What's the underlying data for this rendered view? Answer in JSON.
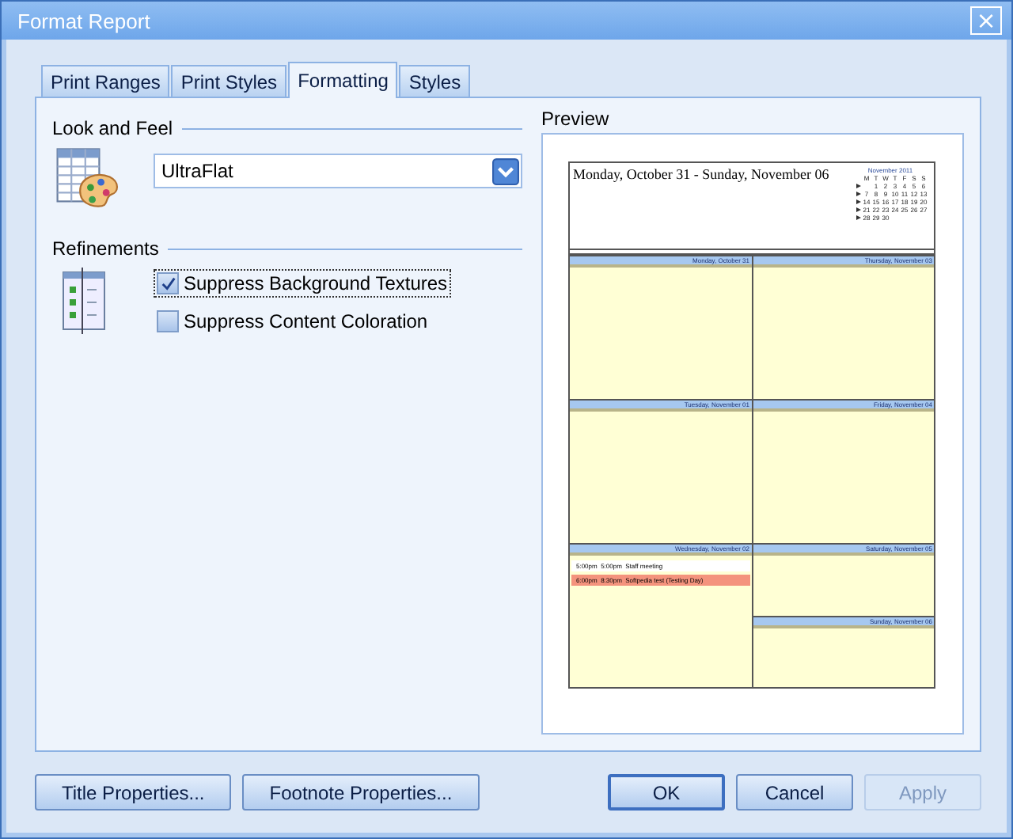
{
  "window": {
    "title": "Format Report",
    "close": "×"
  },
  "tabs": [
    {
      "label": "Print Ranges",
      "selected": false
    },
    {
      "label": "Print Styles",
      "selected": false
    },
    {
      "label": "Formatting",
      "selected": true
    },
    {
      "label": "Styles",
      "selected": false
    }
  ],
  "look_and_feel": {
    "label": "Look and Feel",
    "value": "UltraFlat"
  },
  "refinements": {
    "label": "Refinements",
    "options": [
      {
        "label": "Suppress Background Textures",
        "checked": true,
        "focused": true
      },
      {
        "label": "Suppress Content Coloration",
        "checked": false,
        "focused": false
      }
    ]
  },
  "preview": {
    "label": "Preview",
    "page": {
      "title": "Monday, October 31 - Sunday, November 06",
      "mini_calendar": {
        "month": "November 2011",
        "weekdays": [
          "M",
          "T",
          "W",
          "T",
          "F",
          "S",
          "S"
        ],
        "weeks": [
          [
            "1",
            "2",
            "3",
            "4",
            "5",
            "6"
          ],
          [
            "7",
            "8",
            "9",
            "10",
            "11",
            "12",
            "13"
          ],
          [
            "14",
            "15",
            "16",
            "17",
            "18",
            "19",
            "20"
          ],
          [
            "21",
            "22",
            "23",
            "24",
            "25",
            "26",
            "27"
          ],
          [
            "28",
            "29",
            "30"
          ]
        ]
      },
      "columns": [
        [
          {
            "header": "Monday, October 31",
            "kind": "weekday"
          },
          {
            "header": "Tuesday, November 01",
            "kind": "weekday"
          },
          {
            "header": "Wednesday, November 02",
            "kind": "weekday",
            "events": [
              {
                "start": "5:00pm",
                "end": "5:00pm",
                "subject": "Staff meeting",
                "color": "#ffffff"
              },
              {
                "start": "6:00pm",
                "end": "8:30pm",
                "subject": "Softpedia test (Testing Day)",
                "color": "#f4937d"
              }
            ]
          }
        ],
        [
          {
            "header": "Thursday, November 03",
            "kind": "weekday"
          },
          {
            "header": "Friday, November 04",
            "kind": "weekday"
          },
          {
            "header": "Saturday, November 05",
            "kind": "weekend"
          },
          {
            "header": "Sunday, November 06",
            "kind": "weekend"
          }
        ]
      ]
    }
  },
  "buttons": {
    "left": [
      {
        "label": "Title Properties...",
        "disabled": false,
        "default": false
      },
      {
        "label": "Footnote Properties...",
        "disabled": false,
        "default": false
      }
    ],
    "right": [
      {
        "label": "OK",
        "disabled": false,
        "default": true
      },
      {
        "label": "Cancel",
        "disabled": false,
        "default": false
      },
      {
        "label": "Apply",
        "disabled": true,
        "default": false
      }
    ]
  }
}
